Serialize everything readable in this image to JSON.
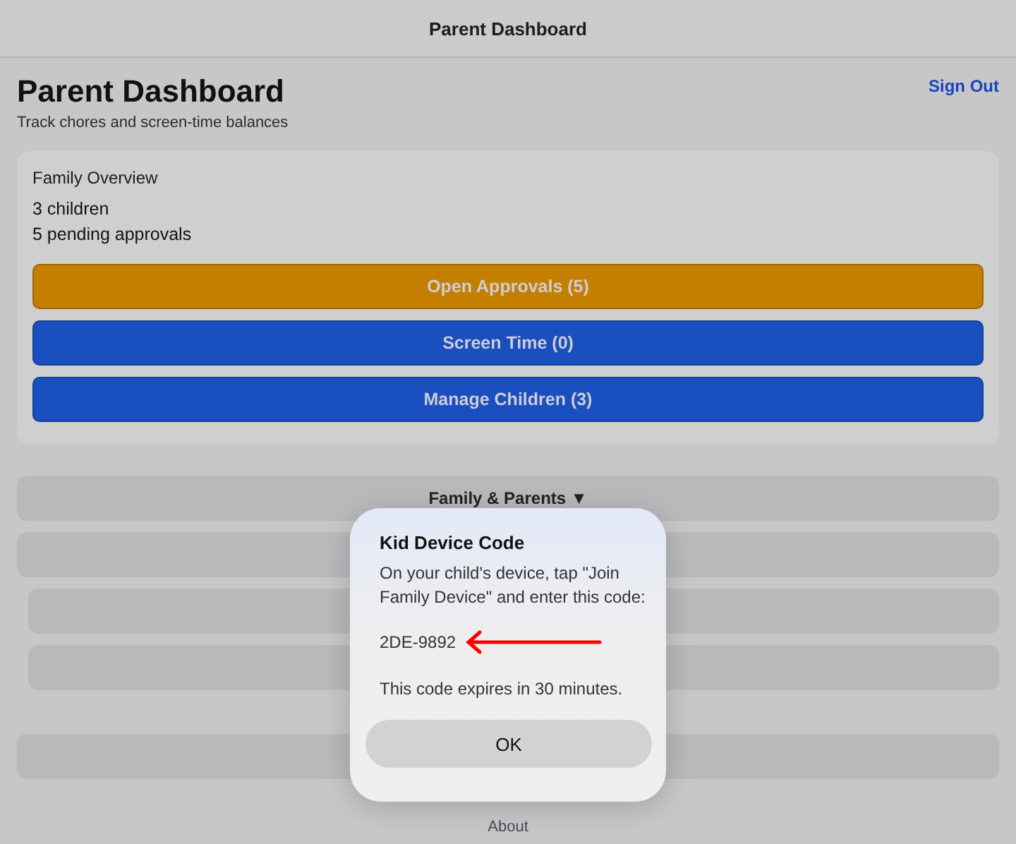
{
  "nav_bar": {
    "title": "Parent Dashboard"
  },
  "header": {
    "title": "Parent Dashboard",
    "subtitle": "Track chores and screen-time balances",
    "sign_out": "Sign Out"
  },
  "overview": {
    "title": "Family Overview",
    "lines": [
      "3 children",
      "5 pending approvals"
    ],
    "buttons": [
      {
        "label": "Open Approvals (5)",
        "kind": "warning"
      },
      {
        "label": "Screen Time (0)",
        "kind": "primary"
      },
      {
        "label": "Manage Children (3)",
        "kind": "primary"
      }
    ]
  },
  "sections": [
    {
      "kind": "header",
      "label": "Family & Parents ▼"
    },
    {
      "kind": "header"
    },
    {
      "kind": "sub"
    },
    {
      "kind": "sub"
    },
    {
      "kind": "gap"
    },
    {
      "kind": "header"
    }
  ],
  "footer": {
    "link": "About"
  },
  "dialog": {
    "title": "Kid Device Code",
    "message": "On your child's device, tap \"Join Family Device\" and enter this code:",
    "code": "2DE-9892",
    "expiry": "This code expires in 30 minutes.",
    "button": "OK"
  }
}
